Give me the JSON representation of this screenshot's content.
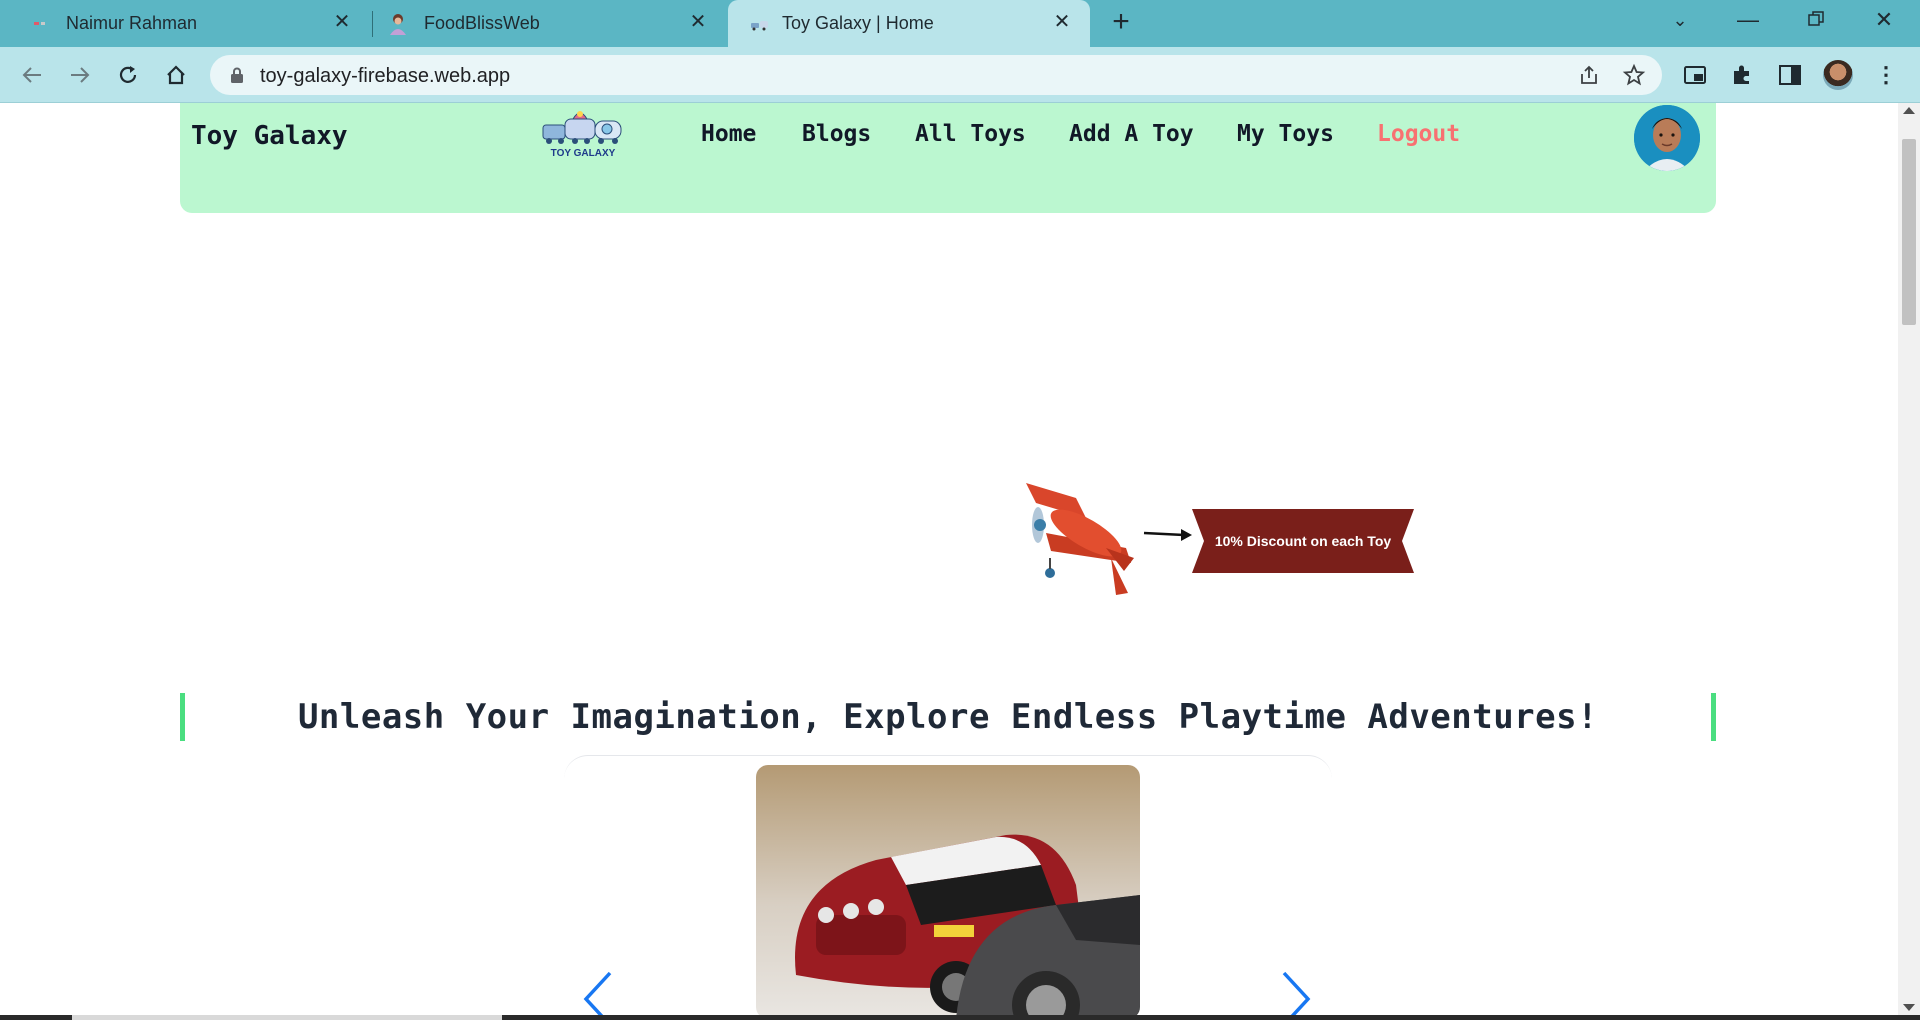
{
  "browser": {
    "tabs": [
      {
        "title": "Naimur Rahman",
        "favicon": "portfolio-icon"
      },
      {
        "title": "FoodBlissWeb",
        "favicon": "chef-icon"
      },
      {
        "title": "Toy Galaxy | Home",
        "favicon": "toy-galaxy-icon",
        "active": true
      }
    ],
    "url": "toy-galaxy-firebase.web.app"
  },
  "site": {
    "brand": "Toy Galaxy",
    "logo_text": "TOY GALAXY",
    "nav": {
      "home": "Home",
      "blogs": "Blogs",
      "all_toys": "All Toys",
      "add_toy": "Add A Toy",
      "my_toys": "My Toys",
      "logout": "Logout"
    },
    "banner_text": "10% Discount on each Toy",
    "section_heading": "Unleash Your Imagination, Explore Endless Playtime Adventures!"
  },
  "colors": {
    "tab_bar": "#5bb6c4",
    "toolbar": "#b9e4ea",
    "navbar": "#bbf7d0",
    "logout": "#f87171",
    "accent_bar": "#4ade80",
    "banner": "#7a1f1a",
    "arrow": "#1877f2"
  }
}
